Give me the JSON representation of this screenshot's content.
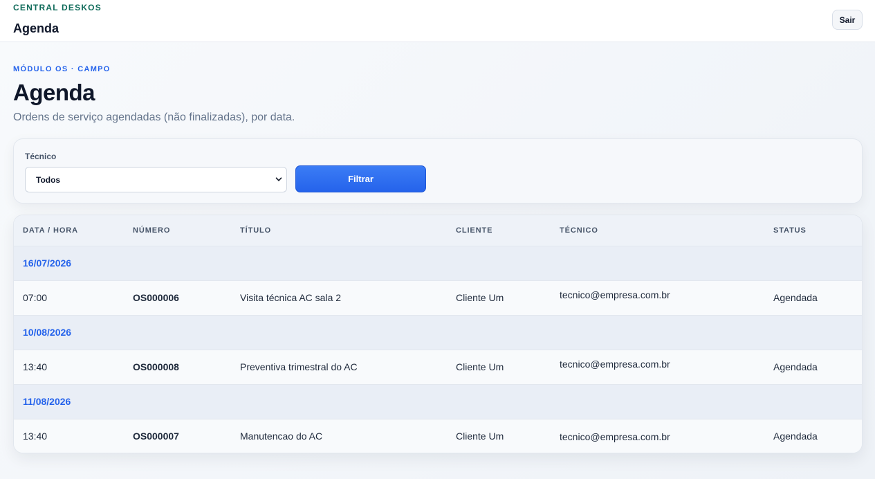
{
  "header": {
    "brand": "CENTRAL DESKOS",
    "title": "Agenda",
    "logout_label": "Sair"
  },
  "page": {
    "eyebrow": "MÓDULO OS · CAMPO",
    "title": "Agenda",
    "description": "Ordens de serviço agendadas (não finalizadas), por data."
  },
  "filter": {
    "label": "Técnico",
    "selected": "Todos",
    "button_label": "Filtrar"
  },
  "table": {
    "columns": [
      "DATA / HORA",
      "NÚMERO",
      "TÍTULO",
      "CLIENTE",
      "TÉCNICO",
      "STATUS"
    ],
    "groups": [
      {
        "date": "16/07/2026",
        "rows": [
          {
            "time": "07:00",
            "number": "OS000006",
            "title": "Visita técnica AC sala 2",
            "client": "Cliente Um",
            "technician": "tecnico@empresa.com.br",
            "status": "Agendada"
          }
        ]
      },
      {
        "date": "10/08/2026",
        "rows": [
          {
            "time": "13:40",
            "number": "OS000008",
            "title": "Preventiva trimestral do AC",
            "client": "Cliente Um",
            "technician": "tecnico@empresa.com.br",
            "status": "Agendada"
          }
        ]
      },
      {
        "date": "11/08/2026",
        "rows": [
          {
            "time": "13:40",
            "number": "OS000007",
            "title": "Manutencao do AC",
            "client": "Cliente Um",
            "technician": "tecnico@empresa.com.br",
            "status": "Agendada"
          }
        ]
      }
    ]
  },
  "icons": {
    "select_chevron": "chevron-down-icon"
  },
  "colors": {
    "accent": "#2563eb",
    "brand": "#0f6b5a"
  }
}
